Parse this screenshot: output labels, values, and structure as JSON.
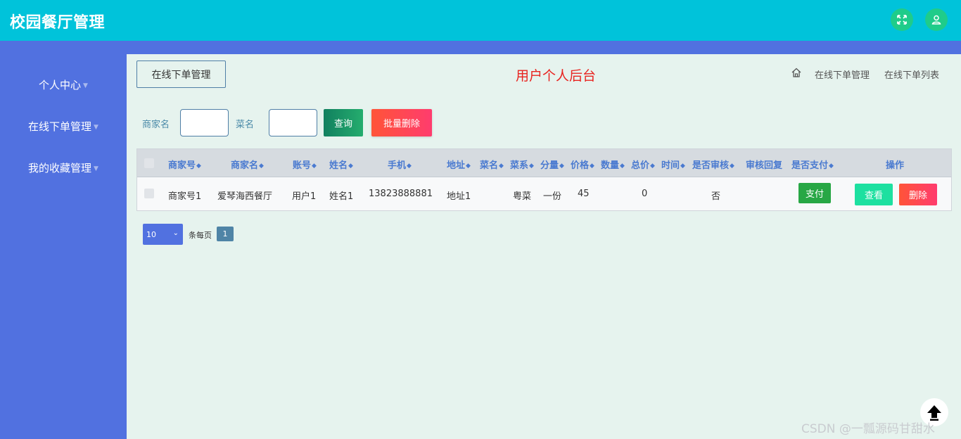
{
  "header": {
    "app_title": "校园餐厅管理",
    "fullscreen_icon": "expand-icon",
    "user_icon": "user-icon"
  },
  "sidebar": {
    "items": [
      {
        "label": "个人中心"
      },
      {
        "label": "在线下单管理"
      },
      {
        "label": "我的收藏管理"
      }
    ]
  },
  "page": {
    "section_button": "在线下单管理",
    "title": "用户个人后台",
    "breadcrumb": [
      "在线下单管理",
      "在线下单列表"
    ]
  },
  "search": {
    "merchant_label": "商家名",
    "dish_label": "菜名",
    "query_button": "查询",
    "batch_delete_button": "批量删除"
  },
  "table": {
    "headers": [
      "商家号",
      "商家名",
      "账号",
      "姓名",
      "手机",
      "地址",
      "菜名",
      "菜系",
      "分量",
      "价格",
      "数量",
      "总价",
      "时间",
      "是否审核",
      "审核回复",
      "是否支付",
      "操作"
    ],
    "rows": [
      {
        "merchant_no": "商家号1",
        "merchant_name": "爱琴海西餐厅",
        "account": "用户1",
        "name": "姓名1",
        "phone": "13823888881",
        "address": "地址1",
        "dish": "",
        "cuisine": "粤菜",
        "portion": "一份",
        "price": "45",
        "quantity": "",
        "total": "0",
        "time": "",
        "reviewed": "否",
        "review_reply": "",
        "pay_button": "支付",
        "view_button": "查看",
        "delete_button": "删除"
      }
    ]
  },
  "pagination": {
    "page_size": "10",
    "per_page_label": "条每页",
    "current_page": "1"
  },
  "watermark": "CSDN @一瓢源码甘甜水",
  "colors": {
    "topbar": "#00c3da",
    "sidebar": "#5171e0",
    "accent_green": "#1fcc8a",
    "danger": "#ff4757"
  }
}
